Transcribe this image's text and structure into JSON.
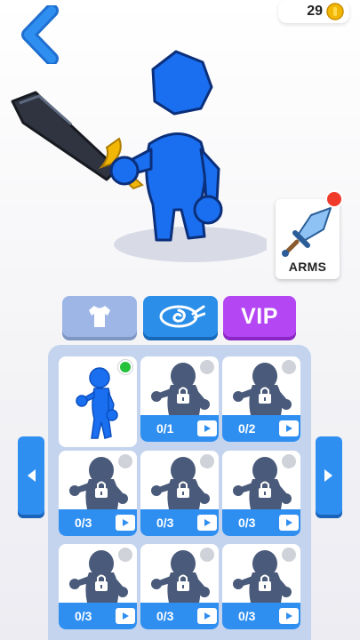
{
  "header": {
    "coin_count": "29"
  },
  "arms": {
    "label": "ARMS"
  },
  "tabs": {
    "vip_label": "VIP"
  },
  "skins": [
    {
      "progress": "",
      "owned": true
    },
    {
      "progress": "0/1",
      "owned": false
    },
    {
      "progress": "0/2",
      "owned": false
    },
    {
      "progress": "0/3",
      "owned": false
    },
    {
      "progress": "0/3",
      "owned": false
    },
    {
      "progress": "0/3",
      "owned": false
    },
    {
      "progress": "0/3",
      "owned": false
    },
    {
      "progress": "0/3",
      "owned": false
    },
    {
      "progress": "0/3",
      "owned": false
    }
  ],
  "colors": {
    "accent_blue": "#2f8ff0",
    "character_blue": "#1a6ff0",
    "vip_purple": "#b447f3",
    "owned_green": "#24c13a",
    "notification_red": "#f03a2a",
    "coin_gold": "#f2b705"
  },
  "icons": [
    "back-arrow-icon",
    "coin-icon",
    "sword-icon",
    "shirt-icon",
    "ninja-headband-icon",
    "lock-icon",
    "play-video-icon",
    "arrow-left-icon",
    "arrow-right-icon"
  ]
}
